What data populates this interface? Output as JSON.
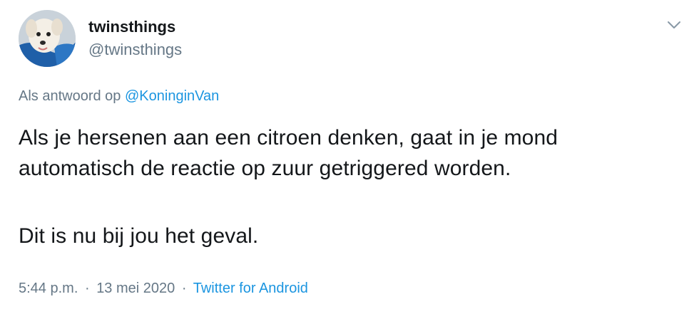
{
  "author": {
    "display_name": "twinsthings",
    "handle": "@twinsthings"
  },
  "reply": {
    "prefix": "Als antwoord op",
    "mention": "@KoninginVan"
  },
  "tweet": {
    "line1": "Als je hersenen aan een citroen denken, gaat in je mond",
    "line2": "automatisch de reactie op zuur getriggered worden.",
    "line3": "Dit is nu bij jou het geval."
  },
  "meta": {
    "time": "5:44 p.m.",
    "separator1": "·",
    "date": "13 mei 2020",
    "separator2": "·",
    "source": "Twitter for Android"
  },
  "icons": {
    "menu": "chevron-down-icon",
    "avatar": "dog-avatar"
  },
  "colors": {
    "link": "#1b95e0",
    "secondary_text": "#657786",
    "primary_text": "#14171a"
  }
}
